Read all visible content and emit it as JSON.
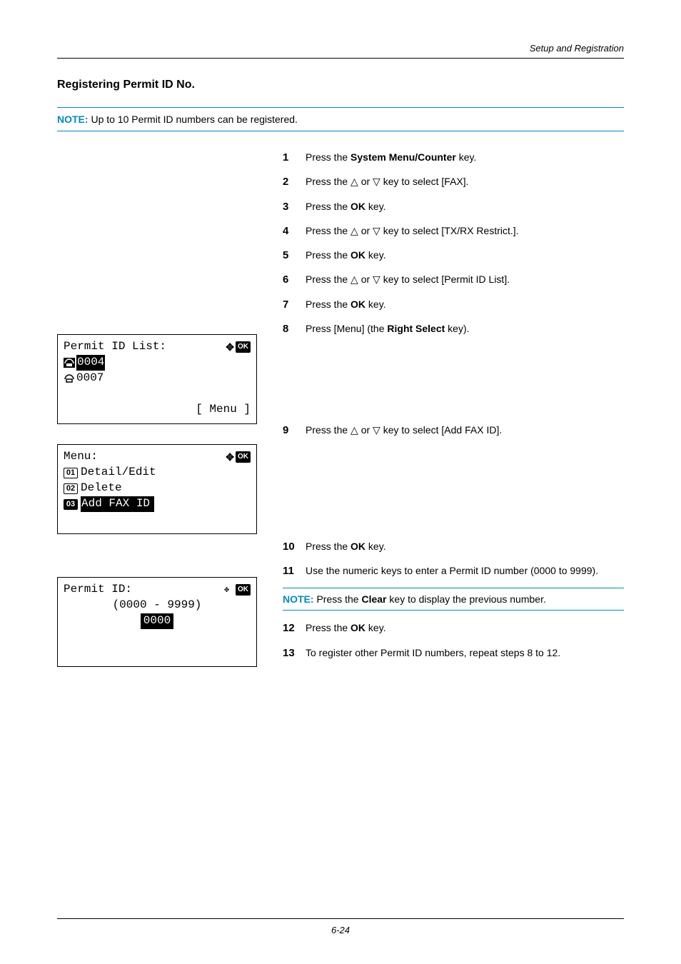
{
  "header_label": "Setup and Registration",
  "subheading": "Registering Permit ID No.",
  "top_note": {
    "prefix": "NOTE:",
    "text": " Up to 10 Permit ID numbers can be registered."
  },
  "steps": {
    "s1": {
      "a": "Press the ",
      "b": "System Menu/Counter",
      "c": " key."
    },
    "s2": {
      "a": "Press the ",
      "mid": " or ",
      "c": " key to select [FAX]."
    },
    "s3": {
      "a": "Press the ",
      "b": "OK",
      "c": " key."
    },
    "s4": {
      "a": "Press the ",
      "mid": " or ",
      "c": " key to select [TX/RX Restrict.]."
    },
    "s5": {
      "a": "Press the ",
      "b": "OK",
      "c": " key."
    },
    "s6": {
      "a": "Press the ",
      "mid": " or ",
      "c": " key to select [Permit ID List]."
    },
    "s7": {
      "a": "Press the ",
      "b": "OK",
      "c": " key."
    },
    "s8": {
      "a": "Press [Menu] (the ",
      "b": "Right Select",
      "c": " key)."
    },
    "s9": {
      "a": "Press the ",
      "mid": " or ",
      "c": " key to select [Add FAX ID]."
    },
    "s10": {
      "a": "Press the ",
      "b": "OK",
      "c": " key."
    },
    "s11": "Use the numeric keys to enter a Permit ID number (0000 to 9999).",
    "s12": {
      "a": "Press the ",
      "b": "OK",
      "c": " key."
    },
    "s13": "To register other Permit ID numbers, repeat steps 8 to 12."
  },
  "note11": {
    "prefix": "NOTE:",
    "a": " Press the ",
    "b": "Clear",
    "c": " key to display the previous number."
  },
  "lcd1": {
    "title": "Permit ID List:",
    "row1": "0004",
    "row2": "0007",
    "softkey": "[  Menu  ]"
  },
  "lcd2": {
    "title": "Menu:",
    "n1": "01",
    "r1": "Detail/Edit",
    "n2": "02",
    "r2": "Delete",
    "n3": "03",
    "r3": "Add FAX ID"
  },
  "lcd3": {
    "title": "Permit ID:",
    "range": "(0000 - 9999)",
    "value": "0000"
  },
  "ok_text": "OK",
  "footer": "6-24"
}
